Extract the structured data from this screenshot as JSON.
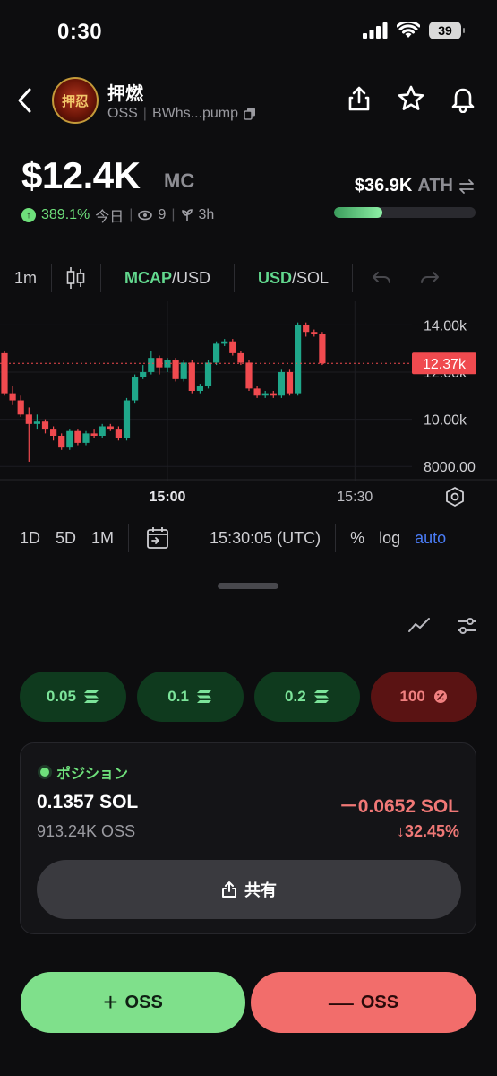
{
  "status": {
    "time": "0:30",
    "battery": "39"
  },
  "token": {
    "name": "押燃",
    "avatar_text": "押忍",
    "symbol": "OSS",
    "address": "BWhs...pump"
  },
  "market": {
    "mc_value": "$12.4K",
    "mc_label": "MC",
    "change_pct": "389.1%",
    "period": "今日",
    "holders": "9",
    "age": "3h",
    "ath_value": "$36.9K",
    "ath_label": "ATH",
    "ath_progress": 0.34
  },
  "chart_toolbar": {
    "interval": "1m",
    "mcap": "MCAP",
    "usd": "/USD",
    "usd2": "USD",
    "sol": "/SOL"
  },
  "chart_data": {
    "type": "candlestick",
    "current_price": 12370,
    "current_label": "12.37k",
    "ylim": [
      7400,
      15000
    ],
    "y_ticks": [
      {
        "value": 14000,
        "label": "14.00k"
      },
      {
        "value": 12000,
        "label": "12.00k"
      },
      {
        "value": 10000,
        "label": "10.00k"
      },
      {
        "value": 8000,
        "label": "8000.00"
      }
    ],
    "x_ticks": [
      {
        "index": 20,
        "label": "15:00",
        "bold": true
      },
      {
        "index": 43,
        "label": "15:30",
        "bold": false
      }
    ],
    "candles": [
      [
        12800,
        11100,
        12900,
        11000
      ],
      [
        11100,
        10800,
        11400,
        10600
      ],
      [
        10800,
        10200,
        11000,
        10100
      ],
      [
        10200,
        9800,
        10500,
        8200
      ],
      [
        9800,
        9900,
        10200,
        9600
      ],
      [
        9900,
        9600,
        10000,
        9400
      ],
      [
        9600,
        9300,
        9700,
        9100
      ],
      [
        9300,
        8800,
        9400,
        8700
      ],
      [
        8800,
        9500,
        9600,
        8700
      ],
      [
        9500,
        9000,
        9600,
        8900
      ],
      [
        9000,
        9400,
        9500,
        8900
      ],
      [
        9400,
        9300,
        9600,
        9200
      ],
      [
        9300,
        9700,
        9800,
        9200
      ],
      [
        9700,
        9600,
        9800,
        9500
      ],
      [
        9600,
        9200,
        9700,
        9100
      ],
      [
        9200,
        10800,
        10900,
        9100
      ],
      [
        10800,
        11800,
        11900,
        10700
      ],
      [
        11800,
        12000,
        12300,
        11700
      ],
      [
        12000,
        12600,
        12900,
        11900
      ],
      [
        12600,
        12200,
        12700,
        11900
      ],
      [
        12200,
        12500,
        12600,
        12000
      ],
      [
        12500,
        11700,
        12600,
        11600
      ],
      [
        11700,
        12400,
        12500,
        11600
      ],
      [
        12400,
        11200,
        12500,
        11100
      ],
      [
        11200,
        11400,
        11500,
        11100
      ],
      [
        11400,
        12400,
        12500,
        11300
      ],
      [
        12400,
        13200,
        13300,
        12300
      ],
      [
        13200,
        13300,
        13400,
        13100
      ],
      [
        13300,
        12800,
        13400,
        12700
      ],
      [
        12800,
        12400,
        12900,
        12300
      ],
      [
        12400,
        11300,
        12500,
        11200
      ],
      [
        11300,
        11000,
        11400,
        10900
      ],
      [
        11000,
        11100,
        11200,
        10900
      ],
      [
        11100,
        11000,
        11200,
        10900
      ],
      [
        11000,
        12000,
        12100,
        10900
      ],
      [
        12000,
        11100,
        12100,
        11000
      ],
      [
        11100,
        14000,
        14100,
        11000
      ],
      [
        14000,
        13700,
        14100,
        13500
      ],
      [
        13700,
        13600,
        13800,
        13500
      ],
      [
        13600,
        12370,
        13700,
        12300
      ]
    ]
  },
  "range_toolbar": {
    "d1": "1D",
    "d5": "5D",
    "m1": "1M",
    "clock": "15:30:05 (UTC)",
    "percent": "%",
    "log": "log",
    "auto": "auto"
  },
  "quick_buy": [
    {
      "label": "0.05",
      "kind": "sol"
    },
    {
      "label": "0.1",
      "kind": "sol"
    },
    {
      "label": "0.2",
      "kind": "sol"
    },
    {
      "label": "100",
      "kind": "percent"
    }
  ],
  "position": {
    "title": "ポジション",
    "sol_amount": "0.1357 SOL",
    "pnl": "－0.0652 SOL",
    "token_amount": "913.24K OSS",
    "pnl_pct": "↓32.45%",
    "share_label": "共有"
  },
  "actions": {
    "buy_sign": "+",
    "buy_label": "OSS",
    "sell_sign": "—",
    "sell_label": "OSS"
  },
  "colors": {
    "up": "#1fa78a",
    "down": "#f04a4f",
    "accent_green": "#6ee07b",
    "accent_red": "#f26d6b",
    "auto_blue": "#4a7cf6"
  }
}
